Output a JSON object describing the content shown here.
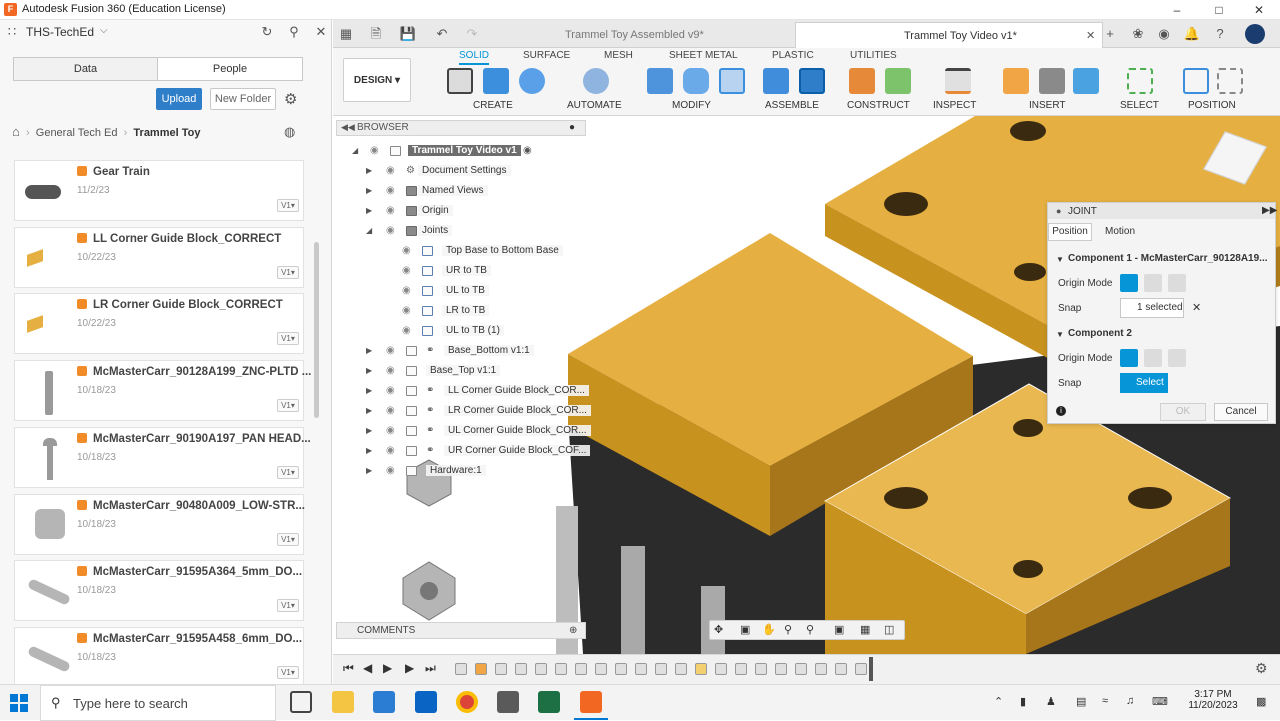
{
  "window": {
    "title": "Autodesk Fusion 360 (Education License)",
    "logo": "F"
  },
  "left_panel": {
    "team": "THS-TechEd",
    "tabs": [
      "Data",
      "People"
    ],
    "upload_label": "Upload",
    "new_folder_label": "New Folder",
    "breadcrumb": {
      "parent": "General Tech Ed",
      "current": "Trammel Toy"
    },
    "files": [
      {
        "name": "Gear Train",
        "date": "11/2/23",
        "version": "V1",
        "thumb": "gears"
      },
      {
        "name": "LL Corner Guide Block_CORRECT",
        "date": "10/22/23",
        "version": "V1",
        "thumb": "block"
      },
      {
        "name": "LR Corner Guide Block_CORRECT",
        "date": "10/22/23",
        "version": "V1",
        "thumb": "block"
      },
      {
        "name": "McMasterCarr_90128A199_ZNC-PLTD ...",
        "date": "10/18/23",
        "version": "V1",
        "thumb": "screw"
      },
      {
        "name": "McMasterCarr_90190A197_PAN HEAD...",
        "date": "10/18/23",
        "version": "V1",
        "thumb": "panscrew"
      },
      {
        "name": "McMasterCarr_90480A009_LOW-STR...",
        "date": "10/18/23",
        "version": "V1",
        "thumb": "nut"
      },
      {
        "name": "McMasterCarr_91595A364_5mm_DO...",
        "date": "10/18/23",
        "version": "V1",
        "thumb": "pin"
      },
      {
        "name": "McMasterCarr_91595A458_6mm_DO...",
        "date": "10/18/23",
        "version": "V1",
        "thumb": "pin"
      }
    ]
  },
  "doc_tabs": [
    {
      "label": "Trammel Toy Assembled v9*",
      "active": false
    },
    {
      "label": "Trammel Toy Video v1*",
      "active": true
    }
  ],
  "toolbar": {
    "workspace": "DESIGN",
    "tabs": [
      "SOLID",
      "SURFACE",
      "MESH",
      "SHEET METAL",
      "PLASTIC",
      "UTILITIES"
    ],
    "active_tab": "SOLID",
    "groups": [
      "CREATE",
      "AUTOMATE",
      "MODIFY",
      "ASSEMBLE",
      "CONSTRUCT",
      "INSPECT",
      "INSERT",
      "SELECT",
      "POSITION"
    ]
  },
  "browser": {
    "title": "BROWSER",
    "root": "Trammel Toy Video v1",
    "items": [
      {
        "label": "Document Settings",
        "level": 1,
        "arrow": "right",
        "icon": "gear"
      },
      {
        "label": "Named Views",
        "level": 1,
        "arrow": "right",
        "icon": "folder"
      },
      {
        "label": "Origin",
        "level": 1,
        "arrow": "right",
        "icon": "folder"
      },
      {
        "label": "Joints",
        "level": 1,
        "arrow": "down",
        "icon": "folder"
      },
      {
        "label": "Top Base to Bottom Base",
        "level": 2,
        "arrow": "",
        "icon": "joint"
      },
      {
        "label": "UR to TB",
        "level": 2,
        "arrow": "",
        "icon": "joint"
      },
      {
        "label": "UL to TB",
        "level": 2,
        "arrow": "",
        "icon": "joint"
      },
      {
        "label": "LR to TB",
        "level": 2,
        "arrow": "",
        "icon": "joint"
      },
      {
        "label": "UL to TB (1)",
        "level": 2,
        "arrow": "",
        "icon": "joint"
      },
      {
        "label": "Base_Bottom v1:1",
        "level": 1,
        "arrow": "right",
        "icon": "link"
      },
      {
        "label": "Base_Top v1:1",
        "level": 1,
        "arrow": "right",
        "icon": "box"
      },
      {
        "label": "LL Corner Guide Block_COR...",
        "level": 1,
        "arrow": "right",
        "icon": "link"
      },
      {
        "label": "LR Corner Guide Block_COR...",
        "level": 1,
        "arrow": "right",
        "icon": "link"
      },
      {
        "label": "UL Corner Guide Block_COR...",
        "level": 1,
        "arrow": "right",
        "icon": "link"
      },
      {
        "label": "UR Corner Guide Block_COF...",
        "level": 1,
        "arrow": "right",
        "icon": "link"
      },
      {
        "label": "Hardware:1",
        "level": 1,
        "arrow": "right",
        "icon": "box"
      }
    ]
  },
  "joint_dialog": {
    "title": "JOINT",
    "tabs": [
      "Position",
      "Motion"
    ],
    "component1": "Component 1 - McMasterCarr_90128A19...",
    "component2": "Component 2",
    "origin_mode_label": "Origin Mode",
    "snap_label": "Snap",
    "snap1_value": "1 selected",
    "snap2_value": "Select",
    "ok_label": "OK",
    "cancel_label": "Cancel"
  },
  "comments_label": "COMMENTS",
  "taskbar": {
    "search_placeholder": "Type here to search",
    "time": "3:17 PM",
    "date": "11/20/2023"
  },
  "colors": {
    "accent": "#0696d7",
    "upload": "#2e7ec9",
    "wood": "#e5b041",
    "wood_dark": "#c8921f",
    "fusion_orange": "#f26722"
  }
}
